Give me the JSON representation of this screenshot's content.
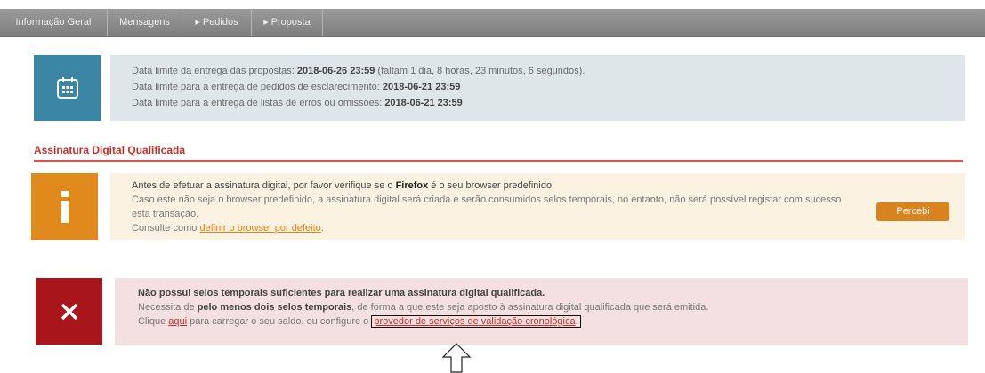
{
  "tabs": [
    {
      "label": "Informação Geral",
      "arrow": false
    },
    {
      "label": "Mensagens",
      "arrow": false
    },
    {
      "label": "Pedidos",
      "arrow": true
    },
    {
      "label": "Proposta",
      "arrow": true
    }
  ],
  "dates": {
    "icon": "calendar-icon",
    "line1_prefix": "Data limite da entrega das propostas: ",
    "line1_value": "2018-06-26 23:59",
    "line1_suffix": " (faltam 1 dia, 8 horas, 23 minutos, 6 segundos).",
    "line2_prefix": "Data limite para a entrega de pedidos de esclarecimento: ",
    "line2_value": "2018-06-21 23:59",
    "line3_prefix": "Data limite para a entrega de listas de erros ou omissões: ",
    "line3_value": "2018-06-21 23:59"
  },
  "signature": {
    "title": "Assinatura Digital Qualificada",
    "info": {
      "icon": "info-icon",
      "l1_a": "Antes de efetuar a assinatura digital, por favor verifique se o ",
      "l1_b": "Firefox",
      "l1_c": " é o seu browser predefinido.",
      "l2": "Caso este não seja o browser predefinido, a assinatura digital será criada e serão consumidos selos temporais, no entanto, não será possível registar com sucesso esta transação.",
      "l3_a": "Consulte como ",
      "l3_link": "definir o browser por defeito",
      "l3_b": ".",
      "button": "Percebi"
    },
    "error": {
      "icon": "close-icon",
      "l1": "Não possui selos temporais suficientes para realizar uma assinatura digital qualificada.",
      "l2_a": "Necessita de ",
      "l2_b": "pelo menos dois selos temporais",
      "l2_c": ", de forma a que este seja aposto à assinatura digital qualificada que será emitida.",
      "l3_a": "Clique ",
      "l3_link1": "aqui",
      "l3_b": " para carregar o seu saldo, ou configure o ",
      "l3_link2": "provedor de serviços de validação cronológica",
      "l3_c": "."
    }
  },
  "colors": {
    "tabbar": "#8a8a8a",
    "dates_icon_bg": "#3a86a4",
    "info_icon_bg": "#e08a1e",
    "error_icon_bg": "#a8151a",
    "accent_red": "#c4302b"
  }
}
